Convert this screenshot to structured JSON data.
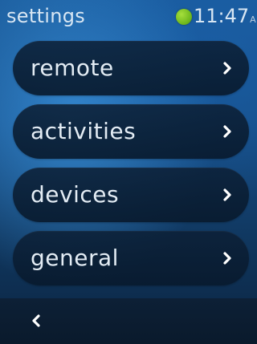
{
  "header": {
    "title": "settings",
    "status_indicator_color": "#7cc423",
    "time": "11:47",
    "time_suffix": "A"
  },
  "menu": {
    "items": [
      {
        "label": "remote",
        "icon": "chevron-right-icon"
      },
      {
        "label": "activities",
        "icon": "chevron-right-icon"
      },
      {
        "label": "devices",
        "icon": "chevron-right-icon"
      },
      {
        "label": "general",
        "icon": "chevron-right-icon"
      }
    ]
  },
  "footer": {
    "back_icon": "chevron-left-icon"
  },
  "colors": {
    "background_top": "#1b5c9c",
    "background_bottom": "#0b2440",
    "menu_button": "#0c2037",
    "text": "#e3ecf4"
  }
}
